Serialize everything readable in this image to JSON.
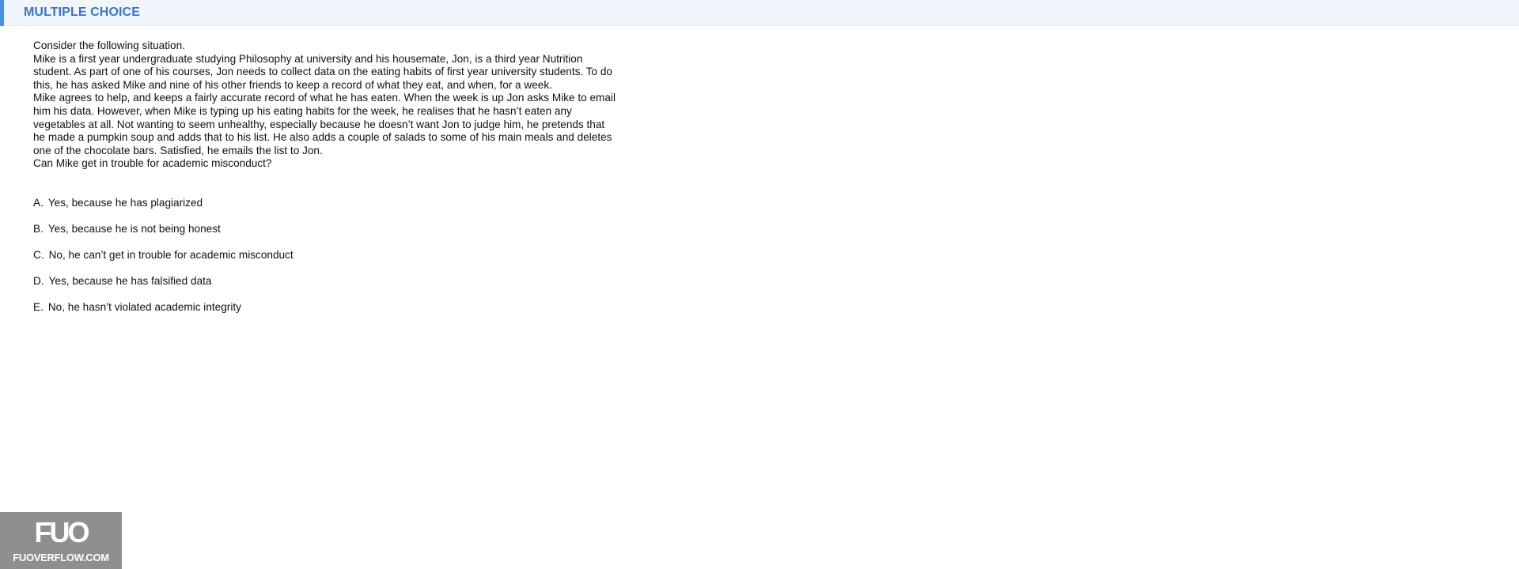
{
  "header": {
    "title": "MULTIPLE CHOICE"
  },
  "question": {
    "paragraphs": [
      "Consider the following situation.",
      "Mike is a first year undergraduate studying Philosophy at university and his housemate, Jon, is a third year Nutrition student. As part of one of his courses, Jon needs to collect data on the eating habits of first year university students. To do this, he has asked Mike and nine of his other friends to keep a record of what they eat, and when, for a week.",
      "Mike agrees to help, and keeps a fairly accurate record of what he has eaten. When the week is up Jon asks Mike to email him his data. However, when Mike is typing up his eating habits for the week, he realises that he hasn’t eaten any vegetables at all. Not wanting to seem unhealthy, especially because he doesn’t want Jon to judge him, he pretends that he made a pumpkin soup and adds that to his list. He also adds a couple of salads to some of his main meals and deletes one of the chocolate bars. Satisfied, he emails the list to Jon.",
      "Can Mike get in trouble for academic misconduct?"
    ]
  },
  "options": [
    {
      "letter": "A.",
      "text": "Yes, because he has plagiarized"
    },
    {
      "letter": "B.",
      "text": "Yes, because he is not being honest"
    },
    {
      "letter": "C.",
      "text": "No, he can’t get in trouble for academic misconduct"
    },
    {
      "letter": "D.",
      "text": "Yes, because he has falsified data"
    },
    {
      "letter": "E.",
      "text": "No, he hasn’t violated academic integrity"
    }
  ],
  "watermark": {
    "logo": "FUO",
    "text": "FUOVERFLOW.COM"
  },
  "colors": {
    "accent": "#4a8ee8",
    "title": "#3c72c3",
    "header_bg": "#f1f6fd",
    "watermark_bg": "#8f8f8f"
  }
}
